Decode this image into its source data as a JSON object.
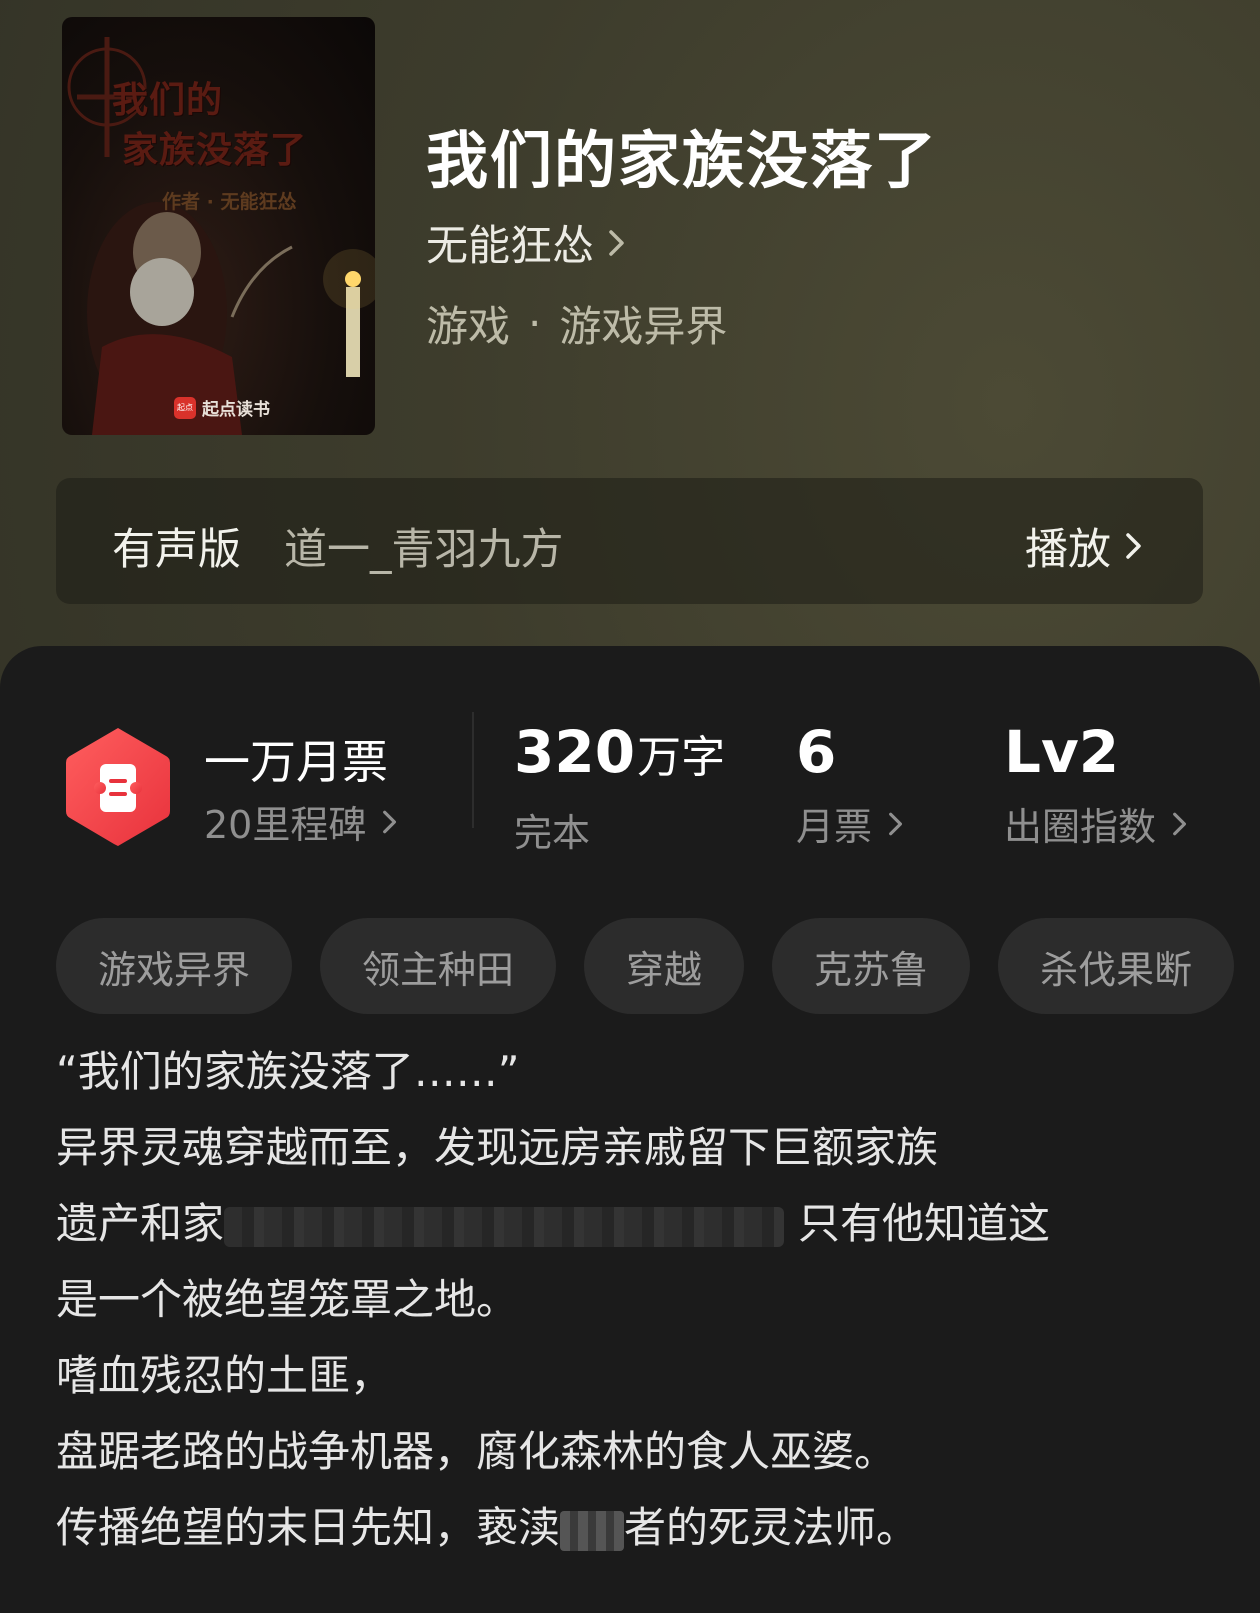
{
  "book": {
    "title": "我们的家族没落了",
    "author": "无能狂怂",
    "genre": "游戏",
    "subgenre": "游戏异界",
    "genre_separator": "·"
  },
  "cover": {
    "title_line1": "我们的",
    "title_line2": "家族没落了",
    "author_text": "作者 · 无能狂怂",
    "publisher": "起点读书",
    "publisher_logo": "起点"
  },
  "audio": {
    "label": "有声版",
    "narrator": "道一_青羽九方",
    "play_label": "播放"
  },
  "stats": {
    "monthly_ticket_title": "一万月票",
    "milestone": "20里程碑",
    "word_count": "320",
    "word_unit": "万字",
    "status": "完本",
    "tickets_value": "6",
    "tickets_label": "月票",
    "level_value": "Lv2",
    "level_label": "出圈指数"
  },
  "tags": [
    "游戏异界",
    "领主种田",
    "穿越",
    "克苏鲁",
    "杀伐果断"
  ],
  "description": {
    "line1": "“我们的家族没落了……”",
    "line2": "异界灵魂穿越而至，发现远房亲戚留下巨额家族",
    "line3_start": "遗产和家",
    "line3_end": "只有他知道这",
    "line4": "是一个被绝望笼罩之地。",
    "line5": "嗜血残忍的土匪，",
    "line6": "盘踞老路的战争机器，腐化森林的食人巫婆。",
    "line7_start": "传播绝望的末日先知，亵渎",
    "line7_end": "者的死灵法师。"
  },
  "colors": {
    "header_bg": "#3d3c2c",
    "panel_bg": "#1b1b1b",
    "tag_bg": "#2c2c2c",
    "accent_red": "#f24b4b"
  },
  "icons": {
    "chevron": "chevron-right-icon",
    "ticket": "monthly-ticket-icon"
  }
}
